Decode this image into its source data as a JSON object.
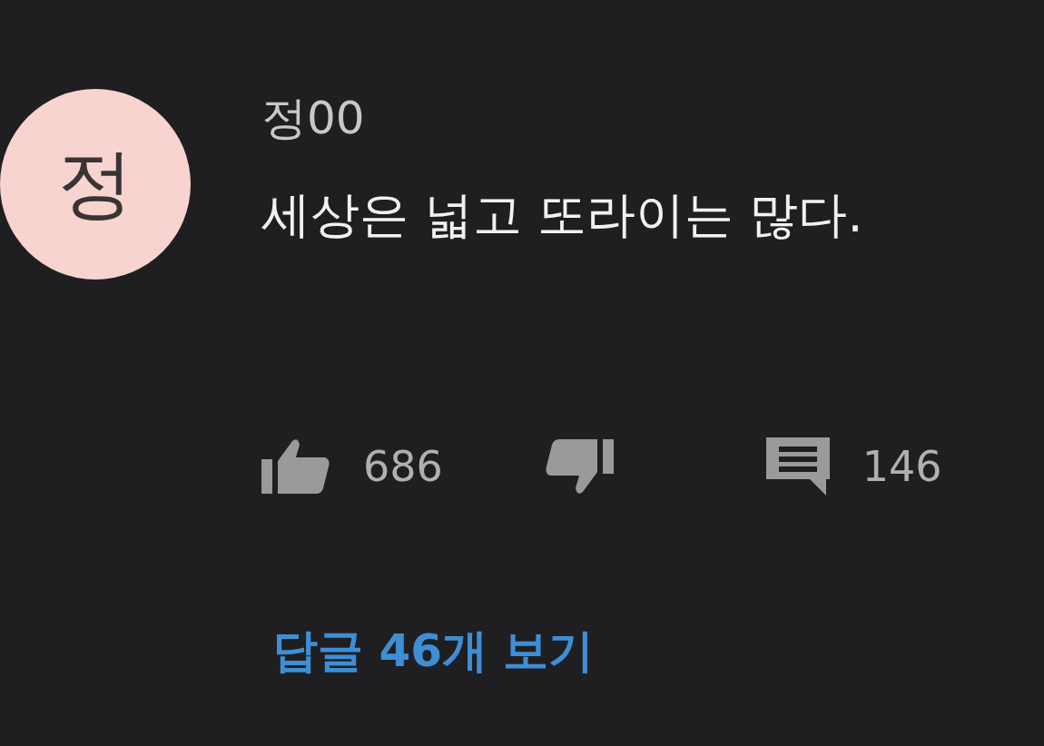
{
  "comment": {
    "avatar_letter": "정",
    "author": "정00",
    "text": "세상은 넓고 또라이는 많다.",
    "like_count": "686",
    "reply_count": "146",
    "view_replies": "답글 46개 보기"
  }
}
